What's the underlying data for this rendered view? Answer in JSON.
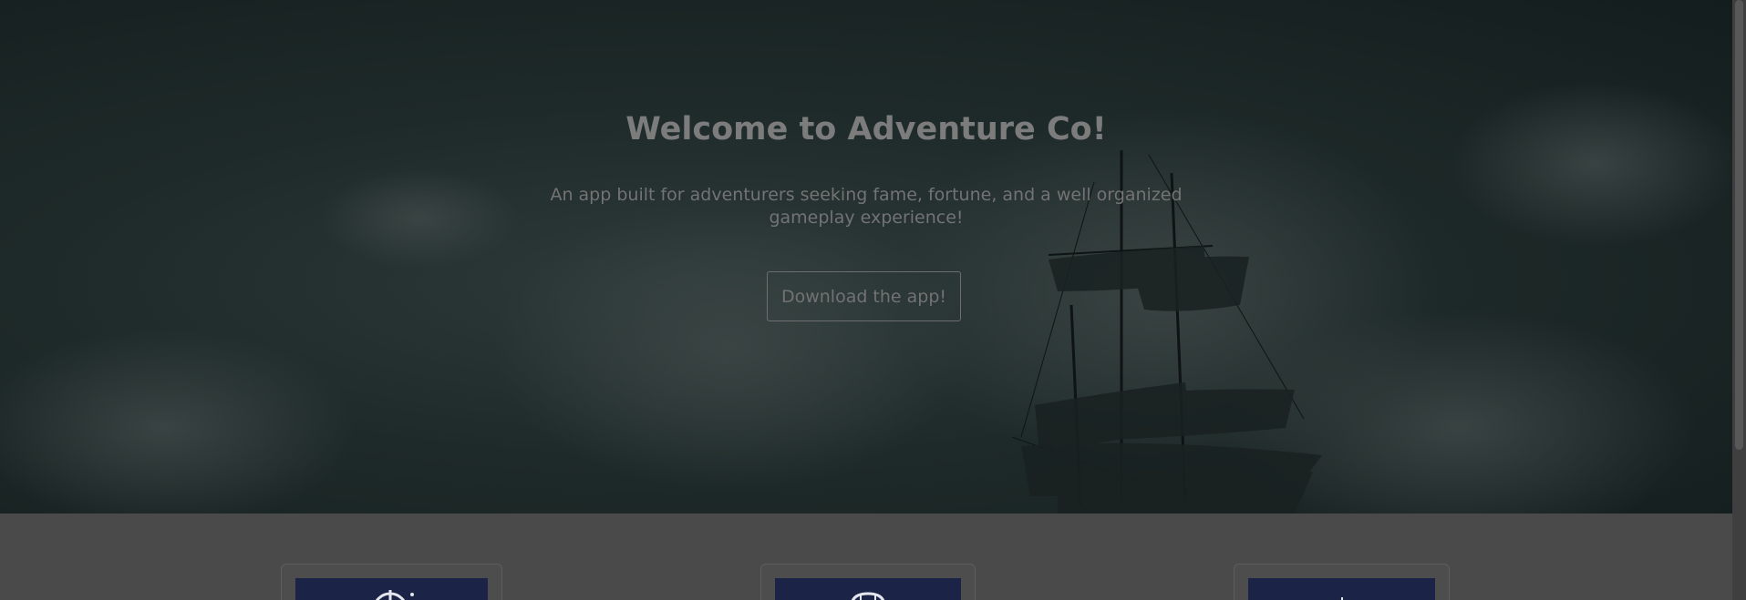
{
  "hero": {
    "title": "Welcome to Adventure Co!",
    "subtitle": "An app built for adventurers seeking fame, fortune, and a well organized gameplay experience!",
    "download_label": "Download the app!"
  },
  "features": {
    "cards": [
      {
        "icon": "compass-icon"
      },
      {
        "icon": "chest-icon"
      },
      {
        "icon": "crown-icon"
      }
    ]
  },
  "colors": {
    "overlay": "#4a4a4a",
    "hero_dark": "#141d1d",
    "card_image": "#1b2446"
  }
}
